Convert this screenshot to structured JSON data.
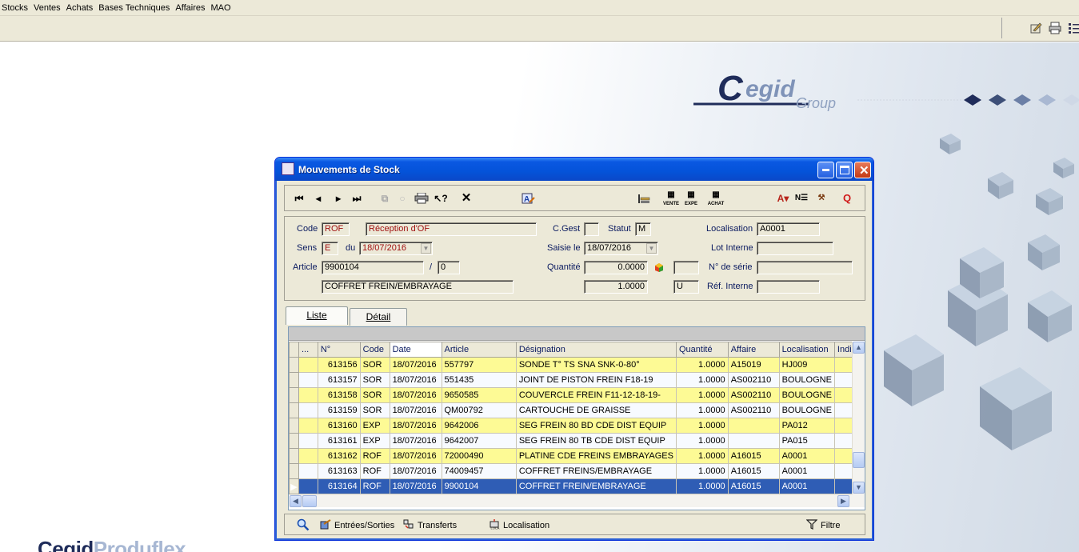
{
  "menubar": {
    "items": [
      "Stocks",
      "Ventes",
      "Achats",
      "Bases Techniques",
      "Affaires",
      "MAO"
    ]
  },
  "branding": {
    "logo_main": "Cegid",
    "logo_sub": "Group",
    "bottom_logo_a": "Cegid",
    "bottom_logo_b": "Produflex"
  },
  "window": {
    "title": "Mouvements de Stock",
    "toolbar": {
      "vente": "VENTE",
      "expe": "EXPE",
      "achat": "ACHAT"
    },
    "form": {
      "code_label": "Code",
      "code_value": "ROF",
      "code_desc": "Réception d'OF",
      "cgest_label": "C.Gest",
      "cgest_value": "",
      "statut_label": "Statut",
      "statut_value": "M",
      "localisation_label": "Localisation",
      "localisation_value": "A0001",
      "sens_label": "Sens",
      "sens_value": "E",
      "du_label": "du",
      "du_value": "18/07/2016",
      "saisie_label": "Saisie le",
      "saisie_value": "18/07/2016",
      "lot_label": "Lot Interne",
      "lot_value": "",
      "article_label": "Article",
      "article_value": "9900104",
      "slash": "/",
      "article_index": "0",
      "quantite_label": "Quantité",
      "quantite_value": "0.0000",
      "quantite_unit": "",
      "serie_label": "N° de série",
      "serie_value": "",
      "designation_value": "COFFRET FREIN/EMBRAYAGE",
      "quantite2_value": "1.0000",
      "unit_value": "U",
      "ref_label": "Réf. Interne",
      "ref_value": ""
    },
    "tabs": {
      "liste": "Liste",
      "detail": "Détail"
    },
    "grid": {
      "columns": [
        "...",
        "N°",
        "Code",
        "Date",
        "Article",
        "Désignation",
        "Quantité",
        "Affaire",
        "Localisation",
        "Indice"
      ],
      "rows": [
        {
          "n": "613156",
          "code": "SOR",
          "date": "18/07/2016",
          "article": "557797",
          "designation": "SONDE T° TS SNA SNK-0-80°",
          "qte": "1.0000",
          "affaire": "A15019",
          "loc": "HJ009",
          "style": "y"
        },
        {
          "n": "613157",
          "code": "SOR",
          "date": "18/07/2016",
          "article": "551435",
          "designation": "JOINT DE PISTON FREIN F18-19",
          "qte": "1.0000",
          "affaire": "AS002110",
          "loc": "BOULOGNE",
          "style": "w"
        },
        {
          "n": "613158",
          "code": "SOR",
          "date": "18/07/2016",
          "article": "9650585",
          "designation": "COUVERCLE FREIN F11-12-18-19-",
          "qte": "1.0000",
          "affaire": "AS002110",
          "loc": "BOULOGNE",
          "style": "y"
        },
        {
          "n": "613159",
          "code": "SOR",
          "date": "18/07/2016",
          "article": "QM00792",
          "designation": "CARTOUCHE DE GRAISSE",
          "qte": "1.0000",
          "affaire": "AS002110",
          "loc": "BOULOGNE",
          "style": "w"
        },
        {
          "n": "613160",
          "code": "EXP",
          "date": "18/07/2016",
          "article": "9642006",
          "designation": "SEG FREIN 80 BD CDE DIST EQUIP",
          "qte": "1.0000",
          "affaire": "",
          "loc": "PA012",
          "style": "y"
        },
        {
          "n": "613161",
          "code": "EXP",
          "date": "18/07/2016",
          "article": "9642007",
          "designation": "SEG FREIN 80 TB CDE DIST EQUIP",
          "qte": "1.0000",
          "affaire": "",
          "loc": "PA015",
          "style": "w"
        },
        {
          "n": "613162",
          "code": "ROF",
          "date": "18/07/2016",
          "article": "72000490",
          "designation": "PLATINE  CDE FREINS EMBRAYAGES",
          "qte": "1.0000",
          "affaire": "A16015",
          "loc": "A0001",
          "style": "y"
        },
        {
          "n": "613163",
          "code": "ROF",
          "date": "18/07/2016",
          "article": "74009457",
          "designation": "COFFRET FREINS/EMBRAYAGE",
          "qte": "1.0000",
          "affaire": "A16015",
          "loc": "A0001",
          "style": "w"
        },
        {
          "n": "613164",
          "code": "ROF",
          "date": "18/07/2016",
          "article": "9900104",
          "designation": "COFFRET FREIN/EMBRAYAGE",
          "qte": "1.0000",
          "affaire": "A16015",
          "loc": "A0001",
          "style": "sel"
        }
      ]
    },
    "bottom": {
      "entrees": "Entrées/Sorties",
      "transferts": "Transferts",
      "localisation": "Localisation",
      "filtre": "Filtre"
    }
  },
  "colors": {
    "title_blue": "#0453d9",
    "row_yellow": "#fdfa95",
    "row_selected": "#2f5db5",
    "label_blue": "#0a1a60"
  }
}
